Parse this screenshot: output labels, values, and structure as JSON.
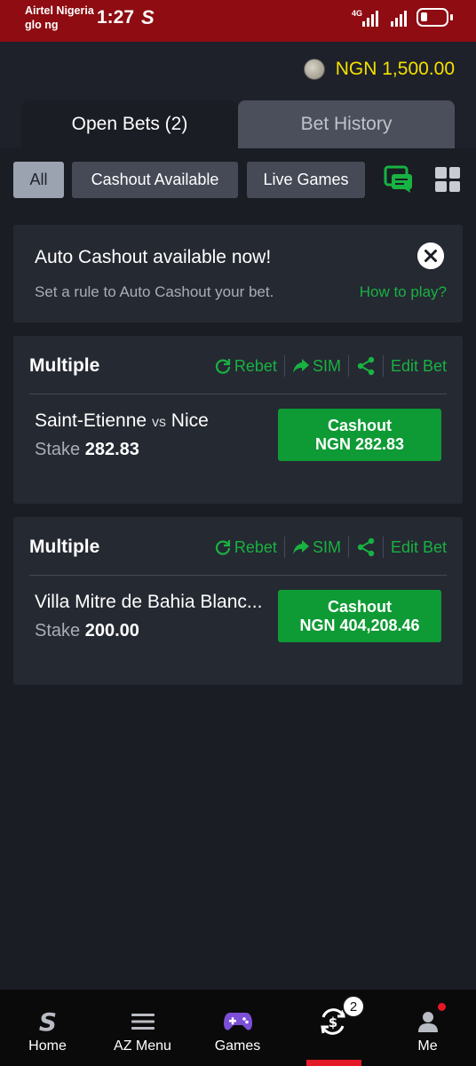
{
  "status_bar": {
    "carrier_1": "Airtel Nigeria",
    "carrier_2": "glo ng",
    "time": "1:27",
    "app_letter": "S",
    "network_type": "4G",
    "bar_color": "#8e0c12"
  },
  "header": {
    "balance": "NGN 1,500.00",
    "balance_color": "#f5e000"
  },
  "tabs": [
    {
      "label": "Open Bets (2)",
      "active": true
    },
    {
      "label": "Bet History",
      "active": false
    }
  ],
  "filters": [
    {
      "label": "All",
      "selected": true
    },
    {
      "label": "Cashout Available",
      "selected": false
    },
    {
      "label": "Live Games",
      "selected": false
    }
  ],
  "icons": {
    "betslip": "betslip-chat-icon",
    "grid": "grid-view-icon"
  },
  "banner": {
    "title": "Auto Cashout available now!",
    "subtitle": "Set a rule to Auto Cashout your bet.",
    "link": "How to play?"
  },
  "bets": [
    {
      "type": "Multiple",
      "actions": {
        "rebet": "Rebet",
        "sim": "SIM",
        "edit": "Edit Bet"
      },
      "home": "Saint-Etienne",
      "vs": "vs",
      "away": "Nice",
      "stake_label": "Stake",
      "stake": "282.83",
      "cashout_label": "Cashout",
      "cashout_amount": "NGN 282.83"
    },
    {
      "type": "Multiple",
      "actions": {
        "rebet": "Rebet",
        "sim": "SIM",
        "edit": "Edit Bet"
      },
      "home": "Villa Mitre de Bahia Blanc...",
      "vs": "",
      "away": "",
      "stake_label": "Stake",
      "stake": "200.00",
      "cashout_label": "Cashout",
      "cashout_amount": "NGN 404,208.46"
    }
  ],
  "bottom_nav": {
    "items": [
      {
        "label": "Home",
        "icon": "sporty-home-icon"
      },
      {
        "label": "AZ Menu",
        "icon": "menu-icon"
      },
      {
        "label": "Games",
        "icon": "gamepad-icon"
      },
      {
        "label": "",
        "icon": "cashout-bets-icon",
        "active": true
      },
      {
        "label": "Me",
        "icon": "user-icon"
      }
    ],
    "bets_badge": "2",
    "accent_color": "#e41827"
  },
  "accent_green": "#18b242"
}
